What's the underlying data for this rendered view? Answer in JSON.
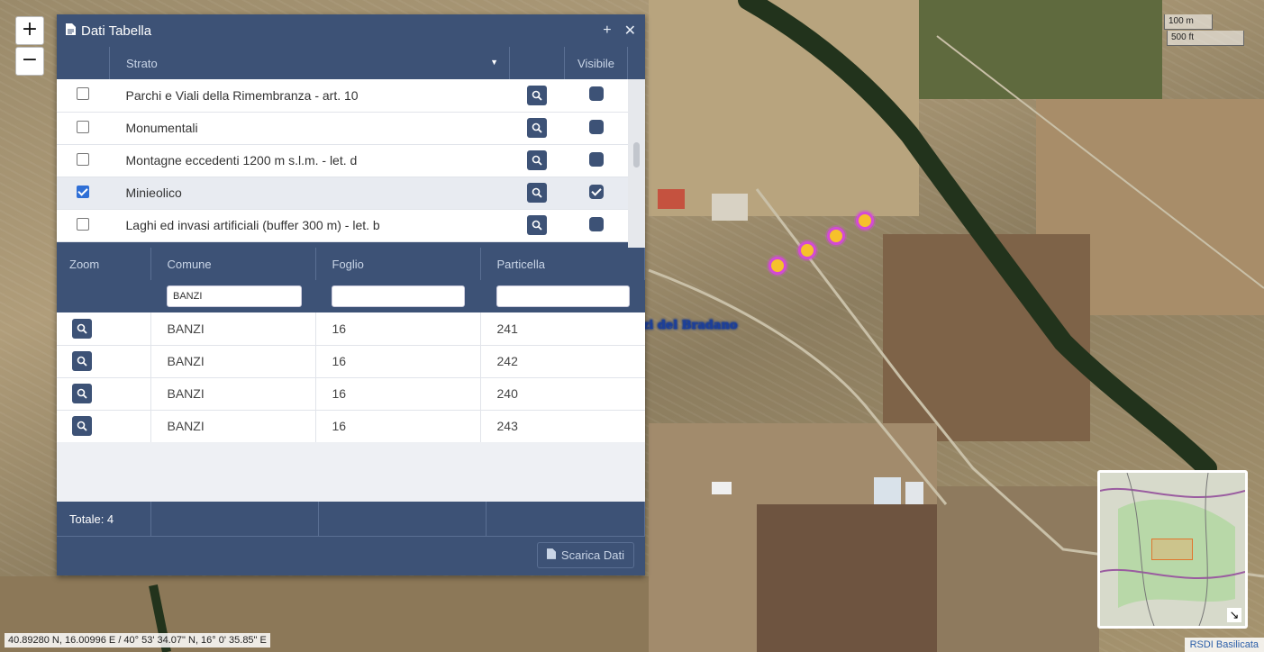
{
  "map": {
    "zoom_in_label": "+",
    "zoom_out_label": "−",
    "scale_metric": "100 m",
    "scale_imperial": "500 ft",
    "coordinates": "40.89280 N, 16.00996 E / 40° 53' 34.07\" N, 16° 0' 35.85\" E",
    "credit": "RSDI Basilicata",
    "place_label": "zi del Bradano",
    "overview_toggle_icon": "expand-arrow-icon"
  },
  "panel": {
    "title": "Dati Tabella",
    "title_icon": "document-icon",
    "add_label": "+",
    "close_label": "✕",
    "layers": {
      "header": {
        "strato": "Strato",
        "visibile": "Visibile"
      },
      "rows": [
        {
          "label": "Parchi e Viali della Rimembranza - art. 10",
          "checked": false,
          "visible": false
        },
        {
          "label": "Monumentali",
          "checked": false,
          "visible": false
        },
        {
          "label": "Montagne eccedenti 1200 m s.l.m. - let. d",
          "checked": false,
          "visible": false
        },
        {
          "label": "Minieolico",
          "checked": true,
          "visible": true
        },
        {
          "label": "Laghi ed invasi artificiali (buffer 300 m) - let. b",
          "checked": false,
          "visible": false
        }
      ]
    },
    "results": {
      "header": {
        "zoom": "Zoom",
        "comune": "Comune",
        "foglio": "Foglio",
        "particella": "Particella"
      },
      "filters": {
        "comune": "BANZI",
        "foglio": "",
        "particella": ""
      },
      "rows": [
        {
          "comune": "BANZI",
          "foglio": "16",
          "particella": "241"
        },
        {
          "comune": "BANZI",
          "foglio": "16",
          "particella": "242"
        },
        {
          "comune": "BANZI",
          "foglio": "16",
          "particella": "240"
        },
        {
          "comune": "BANZI",
          "foglio": "16",
          "particella": "243"
        }
      ],
      "total": "Totale: 4"
    },
    "download_label": "Scarica Dati"
  },
  "colors": {
    "panel_bg": "#3d5276",
    "checkbox_on": "#2f6fd6",
    "poi_ring": "#d34ad6",
    "poi_fill": "#f6c12b",
    "overview_box": "#e0762d"
  }
}
